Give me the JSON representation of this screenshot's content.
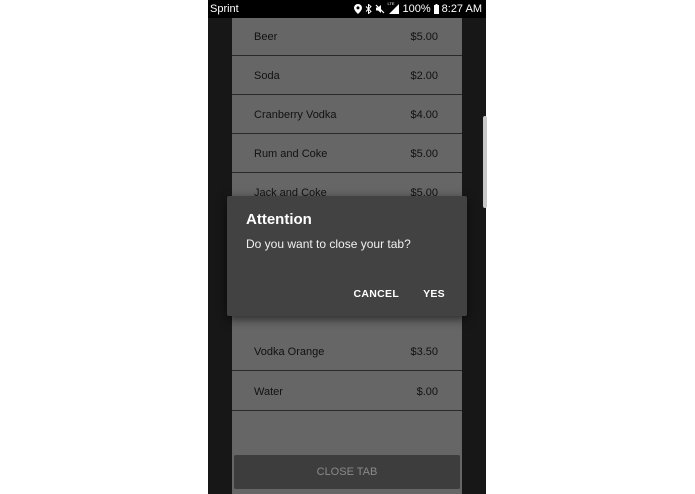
{
  "status_bar": {
    "carrier": "Sprint",
    "battery": "100%",
    "time": "8:27 AM",
    "network_badge": "LTE",
    "icons": [
      "location-icon",
      "bluetooth-icon",
      "mute-icon",
      "signal-icon",
      "battery-icon"
    ]
  },
  "menu": {
    "items": [
      {
        "name": "Beer",
        "price": "$5.00"
      },
      {
        "name": "Soda",
        "price": "$2.00"
      },
      {
        "name": "Cranberry Vodka",
        "price": "$4.00"
      },
      {
        "name": "Rum and Coke",
        "price": "$5.00"
      },
      {
        "name": "Jack and Coke",
        "price": "$5.00"
      },
      {
        "name": "",
        "price": ""
      },
      {
        "name": "",
        "price": ""
      },
      {
        "name": "Vodka Orange",
        "price": "$3.50"
      },
      {
        "name": "Water",
        "price": "$.00"
      }
    ]
  },
  "close_tab_button": "CLOSE TAB",
  "dialog": {
    "title": "Attention",
    "message": "Do you want to close your tab?",
    "cancel_label": "CANCEL",
    "confirm_label": "YES"
  }
}
